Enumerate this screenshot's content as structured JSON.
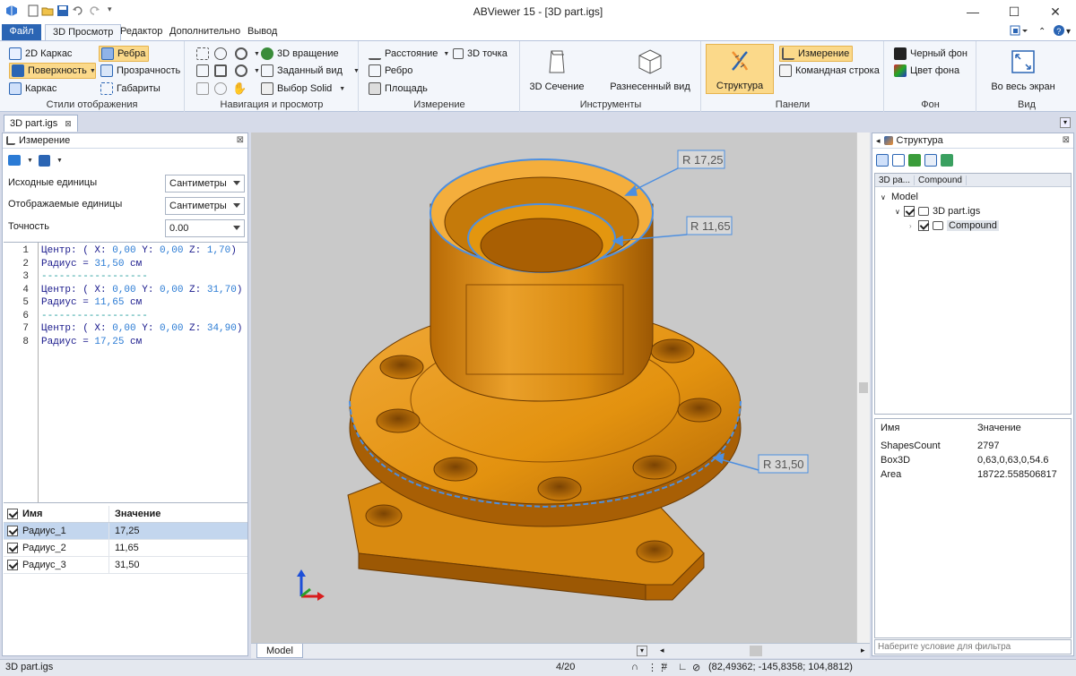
{
  "window": {
    "title": "ABViewer 15 - [3D part.igs]",
    "minimize": "—",
    "maximize": "☐",
    "close": "✕"
  },
  "tabs": [
    {
      "label": "Файл"
    },
    {
      "label": "3D Просмотр"
    },
    {
      "label": "Редактор"
    },
    {
      "label": "Дополнительно"
    },
    {
      "label": "Вывод"
    }
  ],
  "ribbon": {
    "styles": {
      "label": "Стили отображения",
      "wire2d": "2D Каркас",
      "surface": "Поверхность",
      "wire": "Каркас",
      "edges": "Ребра",
      "transparency": "Прозрачность",
      "bounds": "Габариты"
    },
    "nav": {
      "label": "Навигация и просмотр",
      "rotate3d": "3D вращение",
      "presetview": "Заданный вид",
      "solidselect": "Выбор Solid"
    },
    "measure": {
      "label": "Измерение",
      "distance": "Расстояние",
      "point3d": "3D точка",
      "edge": "Ребро",
      "area": "Площадь"
    },
    "tools": {
      "label": "Инструменты",
      "section": "3D Сечение",
      "exploded": "Разнесенный вид"
    },
    "panels": {
      "label": "Панели",
      "structure": "Структура",
      "measurement": "Измерение",
      "cmdline": "Командная строка"
    },
    "background": {
      "label": "Фон",
      "black": "Черный фон",
      "color": "Цвет фона"
    },
    "view": {
      "label": "Вид",
      "fullscreen": "Во весь экран"
    }
  },
  "doc_tab": "3D part.igs",
  "left_panel": {
    "title": "Измерение",
    "source_units_label": "Исходные единицы",
    "source_units_value": "Сантиметры",
    "display_units_label": "Отображаемые единицы",
    "display_units_value": "Сантиметры",
    "precision_label": "Точность",
    "precision_value": "0.00",
    "code_lines": [
      {
        "n": "1",
        "text": "Центр: ( X: 0,00 Y: 0,00 Z: 1,70)"
      },
      {
        "n": "2",
        "text": "Радиус = 31,50 см"
      },
      {
        "n": "3",
        "text": "------------------"
      },
      {
        "n": "4",
        "text": "Центр: ( X: 0,00 Y: 0,00 Z: 31,70)"
      },
      {
        "n": "5",
        "text": "Радиус = 11,65 см"
      },
      {
        "n": "6",
        "text": "------------------"
      },
      {
        "n": "7",
        "text": "Центр: ( X: 0,00 Y: 0,00 Z: 34,90)"
      },
      {
        "n": "8",
        "text": "Радиус = 17,25 см"
      }
    ],
    "table": {
      "col_name": "Имя",
      "col_value": "Значение",
      "rows": [
        {
          "name": "Радиус_1",
          "value": "17,25"
        },
        {
          "name": "Радиус_2",
          "value": "11,65"
        },
        {
          "name": "Радиус_3",
          "value": "31,50"
        }
      ]
    }
  },
  "viewport": {
    "labels": {
      "r1": "R 17,25",
      "r2": "R 11,65",
      "r3": "R 31,50"
    },
    "model_tab": "Model",
    "part_color": "#e8920a",
    "dim_color": "#4d8fe0"
  },
  "right_panel": {
    "title": "Структура",
    "tree_cols": [
      "3D pa...",
      "Compound"
    ],
    "tree": {
      "root": "Model",
      "file": "3D part.igs",
      "child": "Compound"
    },
    "props": {
      "col_name": "Имя",
      "col_value": "Значение",
      "rows": [
        {
          "k": "ShapesCount",
          "v": "2797"
        },
        {
          "k": "Box3D",
          "v": "0,63,0,63,0,54.6"
        },
        {
          "k": "Area",
          "v": "18722.558506817"
        }
      ]
    },
    "filter_placeholder": "Наберите условие для фильтра"
  },
  "status": {
    "file": "3D part.igs",
    "page": "4/20",
    "coords": "(82,49362; -145,8358; 104,8812)"
  }
}
